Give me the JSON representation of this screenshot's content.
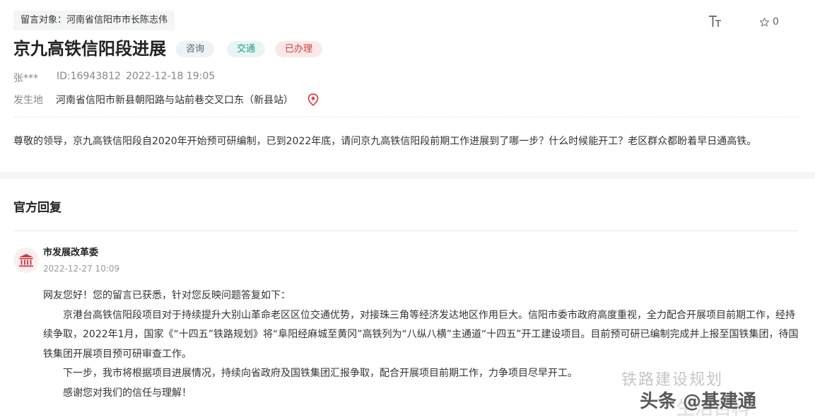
{
  "header": {
    "target_label": "留言对象：河南省信阳市市长陈志伟",
    "font_size_icon": "text-size-icon",
    "favorite_icon": "star-outline-icon",
    "favorite_count": "0"
  },
  "message": {
    "title": "京九高铁信阳段进展",
    "tags": {
      "consult": "咨询",
      "traffic": "交通",
      "status": "已办理"
    },
    "author": "张***",
    "id_text": "ID:16943812",
    "date": "2022-12-18 19:05",
    "location_label": "发生地",
    "location_value": "河南省信阳市新县朝阳路与站前巷交叉口东（新县站）",
    "location_icon": "map-pin-icon",
    "question": "尊敬的领导，京九高铁信阳段自2020年开始预可研编制，已到2022年底，请问京九高铁信阳段前期工作进展到了哪一步？什么时候能开工？老区群众都盼着早日通高铁。"
  },
  "reply": {
    "heading": "官方回复",
    "dept_icon": "government-building-icon",
    "dept_name": "市发展改革委",
    "date": "2022-12-27 10:09",
    "paragraphs": {
      "greeting": "网友您好！您的留言已获悉，针对您反映问题答复如下：",
      "p1": "京港台高铁信阳段项目对于持续提升大别山革命老区区位交通优势，对接珠三角等经济发达地区作用巨大。信阳市委市政府高度重视，全力配合开展项目前期工作，经持续争取，2022年1月，国家《“十四五”铁路规划》将“阜阳经麻城至黄冈”高铁列为“八纵八横”主通道“十四五”开工建设项目。目前预可研已编制完成并上报至国铁集团，待国铁集团开展项目预可研审查工作。",
      "p2": "下一步，我市将根据项目进展情况，持续向省政府及国铁集团汇报争取，配合开展项目前期工作，力争项目尽早开工。",
      "p3": "感谢您对我们的信任与理解！"
    }
  },
  "watermark": {
    "top": "铁路建设规划",
    "bottom": "头条 @基建通",
    "bottom_shadow": "生活百科"
  },
  "colors": {
    "tag_consult_text": "#5a6577",
    "tag_traffic_text": "#1f9c8c",
    "tag_done_text": "#d23a44",
    "pin_red": "#e0454f",
    "dept_icon_red": "#c9404a"
  }
}
